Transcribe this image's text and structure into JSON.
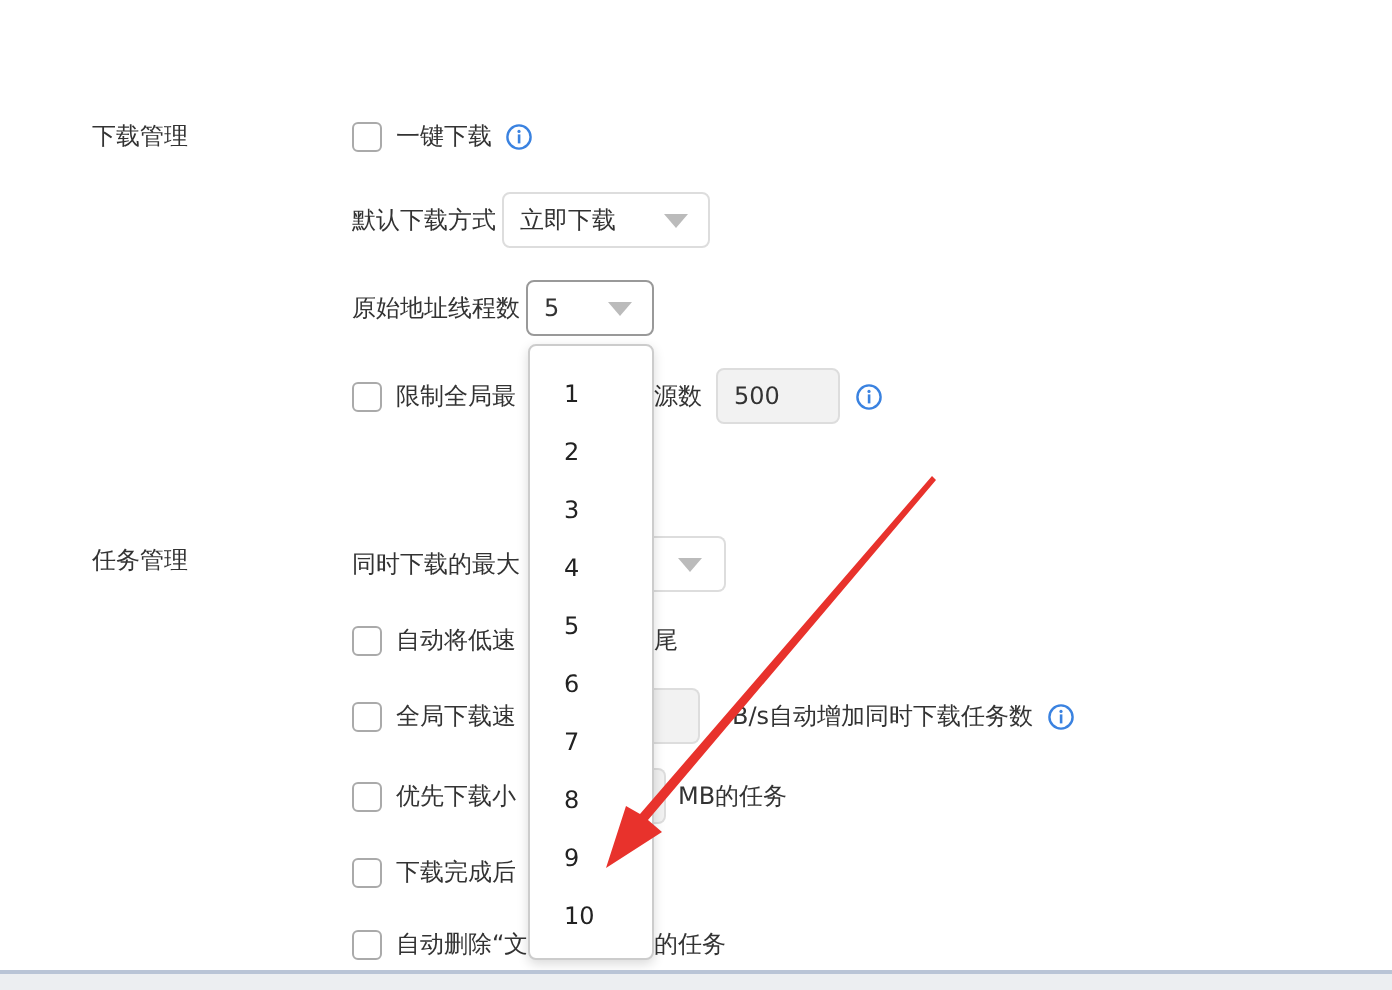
{
  "sections": [
    {
      "title": "下载管理",
      "rows": [
        {
          "checked": false,
          "parts": [
            {
              "kind": "text",
              "text": "一键下载"
            },
            {
              "kind": "info"
            }
          ]
        },
        {
          "parts": [
            {
              "kind": "text",
              "text": "默认下载方式"
            },
            {
              "kind": "select",
              "value": "立即下载",
              "open": false
            }
          ]
        },
        {
          "parts": [
            {
              "kind": "text",
              "text": "原始地址线程数"
            },
            {
              "kind": "select",
              "value": "5",
              "open": true
            }
          ]
        },
        {
          "checked": false,
          "parts": [
            {
              "kind": "text",
              "text": "限制全局最"
            },
            {
              "kind": "covered"
            },
            {
              "kind": "text",
              "text": "源数"
            },
            {
              "kind": "input",
              "value": "500"
            },
            {
              "kind": "info"
            }
          ]
        }
      ]
    },
    {
      "title": "任务管理",
      "rows": [
        {
          "parts": [
            {
              "kind": "text",
              "text": "同时下载的最大"
            },
            {
              "kind": "covered"
            },
            {
              "kind": "select-edge"
            }
          ]
        },
        {
          "checked": false,
          "parts": [
            {
              "kind": "text",
              "text": "自动将低速"
            },
            {
              "kind": "covered"
            },
            {
              "kind": "text",
              "text": "尾"
            }
          ]
        },
        {
          "checked": false,
          "parts": [
            {
              "kind": "text",
              "text": "全局下载速"
            },
            {
              "kind": "covered"
            },
            {
              "kind": "input-edge"
            },
            {
              "kind": "text",
              "text": "B/s自动增加同时下载任务数"
            },
            {
              "kind": "info"
            }
          ]
        },
        {
          "checked": false,
          "parts": [
            {
              "kind": "text",
              "text": "优先下载小"
            },
            {
              "kind": "covered"
            },
            {
              "kind": "input-edge"
            },
            {
              "kind": "text",
              "text": "MB的任务"
            }
          ]
        },
        {
          "checked": false,
          "parts": [
            {
              "kind": "text",
              "text": "下载完成后"
            },
            {
              "kind": "covered"
            }
          ]
        },
        {
          "checked": false,
          "parts": [
            {
              "kind": "text",
              "text": "自动删除“文"
            },
            {
              "kind": "covered"
            },
            {
              "kind": "text",
              "text": "的任务"
            }
          ]
        }
      ]
    }
  ],
  "dropdown": {
    "options": [
      "1",
      "2",
      "3",
      "4",
      "5",
      "6",
      "7",
      "8",
      "9",
      "10"
    ]
  }
}
